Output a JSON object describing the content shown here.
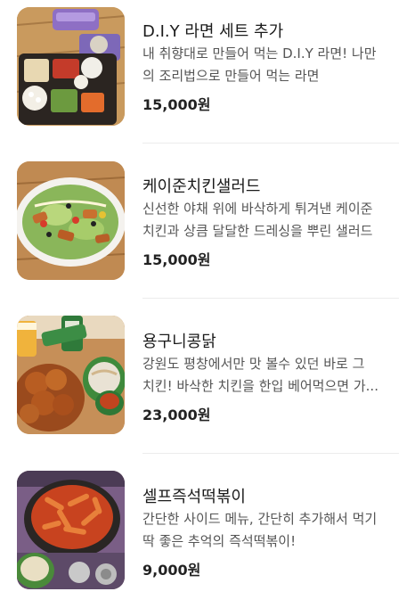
{
  "menu": {
    "items": [
      {
        "title": "D.I.Y 라면 세트 추가",
        "desc_line1": "내 취향대로 만들어 먹는 D.I.Y 라면! 나만",
        "desc_line2": "의 조리법으로 만들어 먹는 라면",
        "price": "15,000원"
      },
      {
        "title": "케이준치킨샐러드",
        "desc_line1": "신선한 야채 위에 바삭하게 튀겨낸 케이준",
        "desc_line2": "치킨과 상큼 달달한 드레싱을 뿌린 샐러드",
        "price": "15,000원"
      },
      {
        "title": "용구니콩닭",
        "desc_line1": "강원도 평창에서만 맛 볼수 있던 바로 그",
        "desc_line2": "치킨! 바삭한 치킨을 한입 베어먹으면 가...",
        "price": "23,000원"
      },
      {
        "title": "셀프즉석떡볶이",
        "desc_line1": "간단한 사이드 메뉴, 간단히 추가해서 먹기",
        "desc_line2": "딱 좋은 추억의 즉석떡볶이!",
        "price": "9,000원"
      }
    ]
  }
}
